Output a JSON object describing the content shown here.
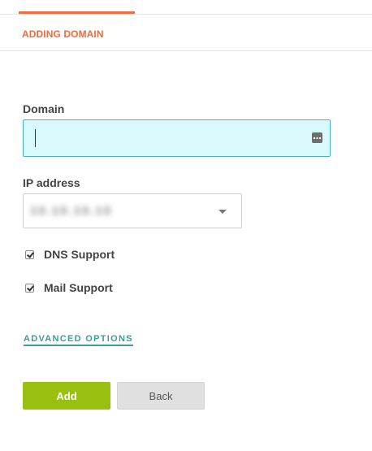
{
  "tabs": {
    "active_accent": "#f26b3a"
  },
  "header": {
    "title": "ADDING DOMAIN"
  },
  "form": {
    "domain": {
      "label": "Domain",
      "value": "",
      "autofill_icon": "password-manager-icon"
    },
    "ip_address": {
      "label": "IP address",
      "selected_value": "10.10.10.10",
      "value_obscured": true,
      "dropdown_icon": "chevron-down-icon"
    },
    "options": [
      {
        "label": "DNS Support",
        "checked": true
      },
      {
        "label": "Mail Support",
        "checked": true
      }
    ],
    "advanced_link": "ADVANCED OPTIONS"
  },
  "actions": {
    "add_label": "Add",
    "back_label": "Back",
    "add_color": "#99bf10",
    "back_color": "#e0e0e0"
  }
}
